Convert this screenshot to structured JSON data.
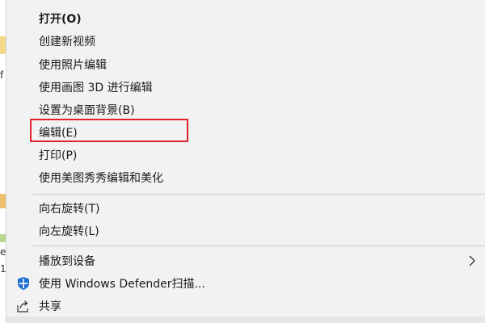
{
  "context_menu": {
    "items": [
      {
        "label": "打开(O)"
      },
      {
        "label": "创建新视频"
      },
      {
        "label": "使用照片编辑"
      },
      {
        "label": "使用画图 3D 进行编辑"
      },
      {
        "label": "设置为桌面背景(B)"
      },
      {
        "label": "编辑(E)"
      },
      {
        "label": "打印(P)"
      },
      {
        "label": "使用美图秀秀编辑和美化"
      },
      {
        "label": "向右旋转(T)"
      },
      {
        "label": "向左旋转(L)"
      },
      {
        "label": "播放到设备",
        "icon": "chevron-right-icon"
      },
      {
        "label": "使用 Windows Defender扫描...",
        "icon": "windows-defender-shield-icon"
      },
      {
        "label": "共享",
        "icon": "share-icon"
      }
    ]
  },
  "background_window": {
    "edge_text": [
      "f",
      "e",
      "1",
      "1"
    ]
  },
  "colors": {
    "menu_background": "#f2f2f2",
    "highlight_border": "#e0242b",
    "defender_blue": "#1e6fd0"
  }
}
